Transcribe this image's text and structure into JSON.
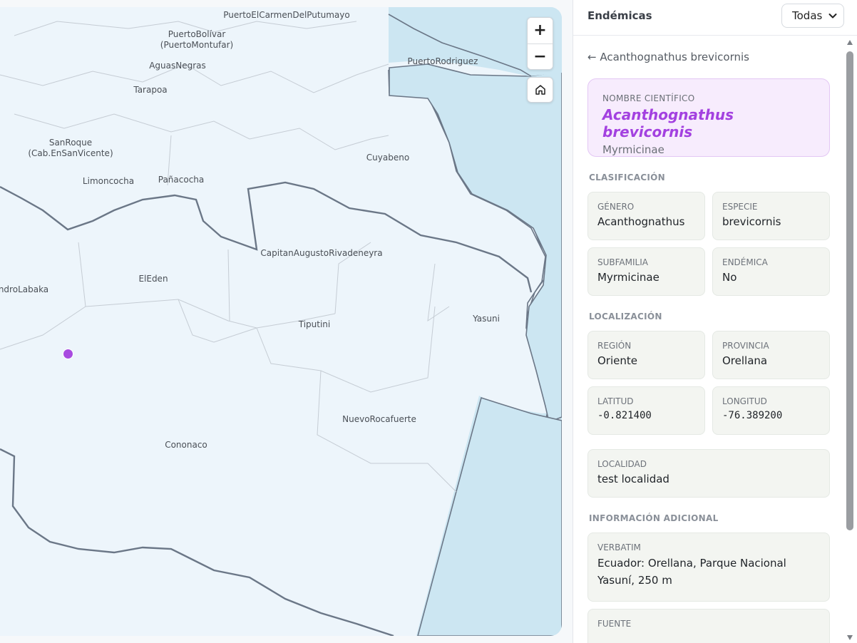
{
  "map": {
    "labels": [
      {
        "text": "PuertoElCarmenDelPutumayo"
      },
      {
        "text": "PuertoBolívar"
      },
      {
        "text": "(PuertoMontufar)"
      },
      {
        "text": "PuertoRodriguez"
      },
      {
        "text": "AguasNegras"
      },
      {
        "text": "Tarapoa"
      },
      {
        "text": "SanRoque"
      },
      {
        "text": "(Cab.EnSanVicente)"
      },
      {
        "text": "Cuyabeno"
      },
      {
        "text": "Limoncocha"
      },
      {
        "text": "Pañacocha"
      },
      {
        "text": "CapitanAugustoRivadeneyra"
      },
      {
        "text": "ElEden"
      },
      {
        "text": "ndroLabaka"
      },
      {
        "text": "Tiputini"
      },
      {
        "text": "Yasuni"
      },
      {
        "text": "NuevoRocafuerte"
      },
      {
        "text": "Cononaco"
      }
    ],
    "zoom_in": "+",
    "zoom_out": "−",
    "marker_color": "#a84be0"
  },
  "panel": {
    "title": "Endémicas",
    "filter_value": "Todas",
    "back_label": "← Acanthognathus brevicornis",
    "scientific": {
      "label": "NOMBRE CIENTÍFICO",
      "name": "Acanthognathus brevicornis",
      "family": "Myrmicinae"
    },
    "classification": {
      "title": "CLASIFICACIÓN",
      "genus_label": "GÉNERO",
      "genus": "Acanthognathus",
      "species_label": "ESPECIE",
      "species": "brevicornis",
      "subfamily_label": "SUBFAMILIA",
      "subfamily": "Myrmicinae",
      "endemic_label": "ENDÉMICA",
      "endemic": "No"
    },
    "location": {
      "title": "LOCALIZACIÓN",
      "region_label": "REGIÓN",
      "region": "Oriente",
      "province_label": "PROVINCIA",
      "province": "Orellana",
      "lat_label": "LATITUD",
      "lat": "-0.821400",
      "lon_label": "LONGITUD",
      "lon": "-76.389200",
      "locality_label": "LOCALIDAD",
      "locality": "test localidad"
    },
    "additional": {
      "title": "INFORMACIÓN ADICIONAL",
      "verbatim_label": "VERBATIM",
      "verbatim": "Ecuador: Orellana, Parque Nacional Yasuní, 250 m",
      "source_label": "FUENTE"
    }
  },
  "colors": {
    "accent": "#a341e0",
    "card_bg": "#f7ecfd",
    "water": "#cce6f2",
    "land": "#edf5fb"
  }
}
